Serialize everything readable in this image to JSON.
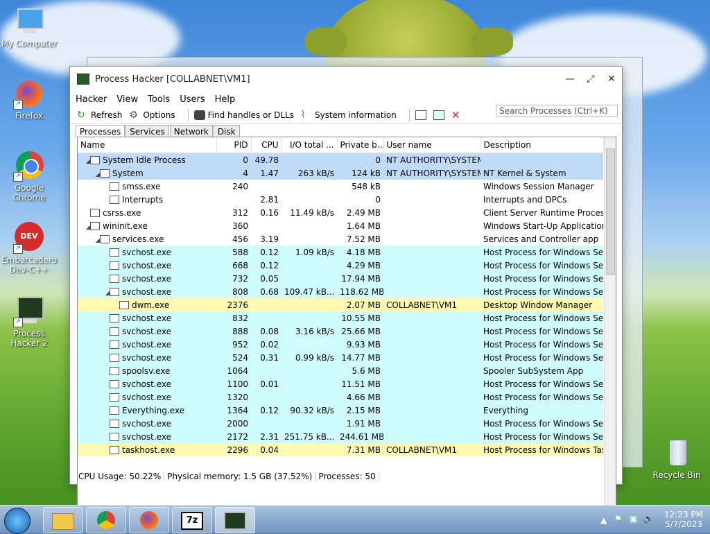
{
  "desktop": {
    "icons": [
      {
        "label": "My Computer"
      },
      {
        "label": "Firefox"
      },
      {
        "label": "Google Chrome"
      },
      {
        "label": "Embarcadero Dev-C++"
      },
      {
        "label": "Process Hacker 2"
      },
      {
        "label": "Recycle Bin"
      }
    ]
  },
  "window": {
    "title": "Process Hacker [COLLABNET\\VM1]",
    "menu": [
      "Hacker",
      "View",
      "Tools",
      "Users",
      "Help"
    ],
    "toolbar": {
      "refresh": "Refresh",
      "options": "Options",
      "find": "Find handles or DLLs",
      "sysinfo": "System information"
    },
    "search_placeholder": "Search Processes (Ctrl+K)",
    "tabs": [
      "Processes",
      "Services",
      "Network",
      "Disk"
    ],
    "columns": [
      "Name",
      "PID",
      "CPU",
      "I/O total ...",
      "Private b...",
      "User name",
      "Description"
    ],
    "rows": [
      {
        "name": "System Idle Process",
        "pid": "0",
        "cpu": "49.78",
        "io": "",
        "priv": "0",
        "user": "NT AUTHORITY\\SYSTEM",
        "desc": "",
        "style": "sel"
      },
      {
        "name": "System",
        "pid": "4",
        "cpu": "1.47",
        "io": "263 kB/s",
        "priv": "124 kB",
        "user": "NT AUTHORITY\\SYSTEM",
        "desc": "NT Kernel & System",
        "style": "sel"
      },
      {
        "name": "smss.exe",
        "pid": "240",
        "cpu": "",
        "io": "",
        "priv": "548 kB",
        "user": "",
        "desc": "Windows Session Manager",
        "style": ""
      },
      {
        "name": "Interrupts",
        "pid": "",
        "cpu": "2.81",
        "io": "",
        "priv": "0",
        "user": "",
        "desc": "Interrupts and DPCs",
        "style": ""
      },
      {
        "name": "csrss.exe",
        "pid": "312",
        "cpu": "0.16",
        "io": "11.49 kB/s",
        "priv": "2.49 MB",
        "user": "",
        "desc": "Client Server Runtime Process",
        "style": ""
      },
      {
        "name": "wininit.exe",
        "pid": "360",
        "cpu": "",
        "io": "",
        "priv": "1.64 MB",
        "user": "",
        "desc": "Windows Start-Up Application",
        "style": ""
      },
      {
        "name": "services.exe",
        "pid": "456",
        "cpu": "3.19",
        "io": "",
        "priv": "7.52 MB",
        "user": "",
        "desc": "Services and Controller app",
        "style": ""
      },
      {
        "name": "svchost.exe",
        "pid": "588",
        "cpu": "0.12",
        "io": "1.09 kB/s",
        "priv": "4.18 MB",
        "user": "",
        "desc": "Host Process for Windows Ser...",
        "style": "svc"
      },
      {
        "name": "svchost.exe",
        "pid": "668",
        "cpu": "0.12",
        "io": "",
        "priv": "4.29 MB",
        "user": "",
        "desc": "Host Process for Windows Ser...",
        "style": "svc"
      },
      {
        "name": "svchost.exe",
        "pid": "732",
        "cpu": "0.05",
        "io": "",
        "priv": "17.94 MB",
        "user": "",
        "desc": "Host Process for Windows Ser...",
        "style": "svc"
      },
      {
        "name": "svchost.exe",
        "pid": "808",
        "cpu": "0.68",
        "io": "109.47 kB...",
        "priv": "118.62 MB",
        "user": "",
        "desc": "Host Process for Windows Ser...",
        "style": "svc"
      },
      {
        "name": "dwm.exe",
        "pid": "2376",
        "cpu": "",
        "io": "",
        "priv": "2.07 MB",
        "user": "COLLABNET\\VM1",
        "desc": "Desktop Window Manager",
        "style": "usr"
      },
      {
        "name": "svchost.exe",
        "pid": "832",
        "cpu": "",
        "io": "",
        "priv": "10.55 MB",
        "user": "",
        "desc": "Host Process for Windows Ser...",
        "style": "svc"
      },
      {
        "name": "svchost.exe",
        "pid": "888",
        "cpu": "0.08",
        "io": "3.16 kB/s",
        "priv": "25.66 MB",
        "user": "",
        "desc": "Host Process for Windows Ser...",
        "style": "svc"
      },
      {
        "name": "svchost.exe",
        "pid": "952",
        "cpu": "0.02",
        "io": "",
        "priv": "9.93 MB",
        "user": "",
        "desc": "Host Process for Windows Ser...",
        "style": "svc"
      },
      {
        "name": "svchost.exe",
        "pid": "524",
        "cpu": "0.31",
        "io": "0.99 kB/s",
        "priv": "14.77 MB",
        "user": "",
        "desc": "Host Process for Windows Ser...",
        "style": "svc"
      },
      {
        "name": "spoolsv.exe",
        "pid": "1064",
        "cpu": "",
        "io": "",
        "priv": "5.6 MB",
        "user": "",
        "desc": "Spooler SubSystem App",
        "style": "svc"
      },
      {
        "name": "svchost.exe",
        "pid": "1100",
        "cpu": "0.01",
        "io": "",
        "priv": "11.51 MB",
        "user": "",
        "desc": "Host Process for Windows Ser...",
        "style": "svc"
      },
      {
        "name": "svchost.exe",
        "pid": "1320",
        "cpu": "",
        "io": "",
        "priv": "4.66 MB",
        "user": "",
        "desc": "Host Process for Windows Ser...",
        "style": "svc"
      },
      {
        "name": "Everything.exe",
        "pid": "1364",
        "cpu": "0.12",
        "io": "90.32 kB/s",
        "priv": "2.15 MB",
        "user": "",
        "desc": "Everything",
        "style": "svc"
      },
      {
        "name": "svchost.exe",
        "pid": "2000",
        "cpu": "",
        "io": "",
        "priv": "1.91 MB",
        "user": "",
        "desc": "Host Process for Windows Ser...",
        "style": "svc"
      },
      {
        "name": "svchost.exe",
        "pid": "2172",
        "cpu": "2.31",
        "io": "251.75 kB...",
        "priv": "244.61 MB",
        "user": "",
        "desc": "Host Process for Windows Ser...",
        "style": "svc"
      },
      {
        "name": "taskhost.exe",
        "pid": "2296",
        "cpu": "0.04",
        "io": "",
        "priv": "7.31 MB",
        "user": "COLLABNET\\VM1",
        "desc": "Host Process for Windows Tas...",
        "style": "usr"
      }
    ],
    "status": {
      "cpu": "CPU Usage: 50.22%",
      "mem": "Physical memory: 1.5 GB (37.52%)",
      "procs": "Processes: 50"
    }
  },
  "taskbar": {
    "time": "12:23 PM",
    "date": "5/7/2023"
  }
}
